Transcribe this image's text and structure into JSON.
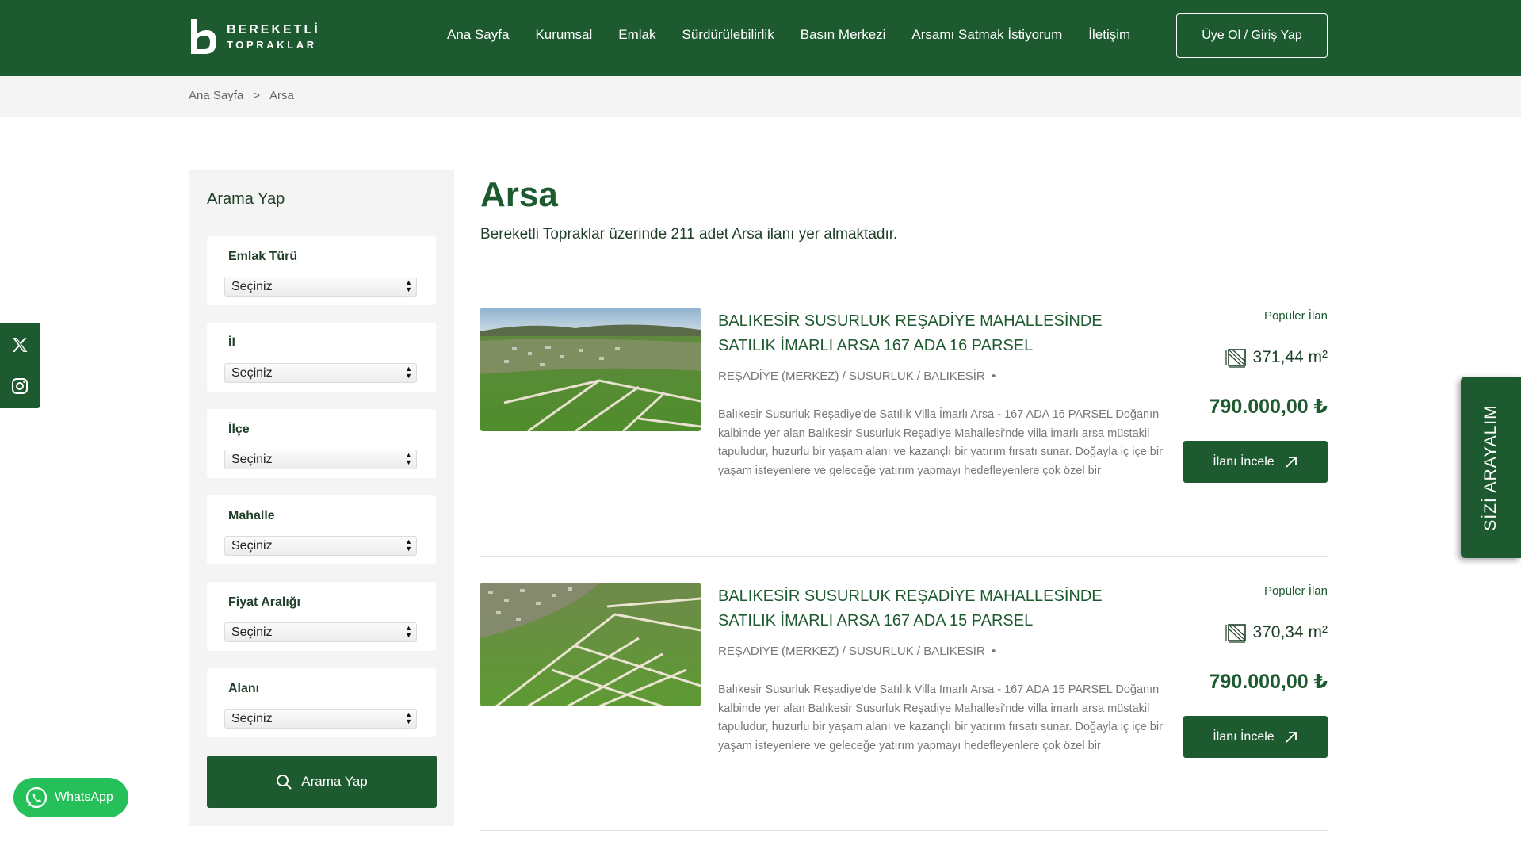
{
  "header": {
    "logo_line1": "BEREKETLİ",
    "logo_line2": "TOPRAKLAR",
    "nav": [
      "Ana Sayfa",
      "Kurumsal",
      "Emlak",
      "Sürdürülebilirlik",
      "Basın Merkezi",
      "Arsamı Satmak İstiyorum",
      "İletişim"
    ],
    "login_label": "Üye Ol / Giriş Yap"
  },
  "breadcrumb": {
    "home": "Ana Sayfa",
    "separator": ">",
    "current": "Arsa"
  },
  "social": {
    "icons": [
      "x-icon",
      "instagram-icon"
    ]
  },
  "sidebar": {
    "title": "Arama Yap",
    "filters": [
      {
        "label": "Emlak Türü",
        "value": "Seçiniz"
      },
      {
        "label": "İl",
        "value": "Seçiniz"
      },
      {
        "label": "İlçe",
        "value": "Seçiniz"
      },
      {
        "label": "Mahalle",
        "value": "Seçiniz"
      },
      {
        "label": "Fiyat Aralığı",
        "value": "Seçiniz"
      },
      {
        "label": "Alanı",
        "value": "Seçiniz"
      }
    ],
    "search_button": "Arama Yap"
  },
  "main": {
    "title": "Arsa",
    "subtitle": "Bereketli Topraklar üzerinde 211 adet Arsa ilanı yer almaktadır.",
    "listings": [
      {
        "title": "BALIKESİR SUSURLUK REŞADİYE MAHALLESİNDE SATILIK İMARLI ARSA 167 ADA 16 PARSEL",
        "location": "REŞADİYE (MERKEZ) / SUSURLUK / BALIKESİR",
        "dot": "•",
        "description": "Balıkesir Susurluk Reşadiye'de Satılık Villa İmarlı Arsa - 167 ADA 16 PARSEL Doğanın kalbinde yer alan Balıkesir Susurluk Reşadiye Mahallesi'nde villa imarlı arsa müstakil tapuludur, huzurlu bir yaşam alanı ve kazançlı bir yatırım fırsatı sunar. Doğayla iç içe bir yaşam isteyenlere ve geleceğe yatırım yapmayı hedefleyenlere çok özel bir",
        "badge": "Popüler İlan",
        "area": "371,44 m²",
        "price": "790.000,00 ₺",
        "button": "İlanı İncele"
      },
      {
        "title": "BALIKESİR SUSURLUK REŞADİYE MAHALLESİNDE SATILIK İMARLI ARSA 167 ADA 15 PARSEL",
        "location": "REŞADİYE (MERKEZ) / SUSURLUK / BALIKESİR",
        "dot": "•",
        "description": "Balıkesir Susurluk Reşadiye'de Satılık Villa İmarlı Arsa - 167 ADA 15 PARSEL Doğanın kalbinde yer alan Balıkesir Susurluk Reşadiye Mahallesi'nde villa imarlı arsa müstakil tapuludur, huzurlu bir yaşam alanı ve kazançlı bir yatırım fırsatı sunar. Doğayla iç içe bir yaşam isteyenlere ve geleceğe yatırım yapmayı hedefleyenlere çok özel bir",
        "badge": "Popüler İlan",
        "area": "370,34 m²",
        "price": "790.000,00 ₺",
        "button": "İlanı İncele"
      }
    ]
  },
  "side_tab": {
    "label": "SİZİ ARAYALIM"
  },
  "whatsapp": {
    "label": "WhatsApp"
  },
  "colors": {
    "brand_green": "#1e5a30",
    "whatsapp_green": "#25c05a",
    "sidebar_bg": "#f4f4f4"
  }
}
